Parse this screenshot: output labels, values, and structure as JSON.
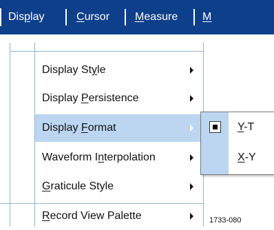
{
  "menubar": {
    "items": [
      {
        "label_pre": "Dis",
        "label_u": "p",
        "label_post": "lay"
      },
      {
        "label_pre": "",
        "label_u": "C",
        "label_post": "ursor"
      },
      {
        "label_pre": "",
        "label_u": "M",
        "label_post": "easure"
      },
      {
        "label_pre": "",
        "label_u": "M",
        "label_post": ""
      }
    ]
  },
  "menu": {
    "items": [
      {
        "pre": "Display St",
        "u": "y",
        "post": "le",
        "has_submenu": true
      },
      {
        "pre": "Display ",
        "u": "P",
        "post": "ersistence",
        "has_submenu": true
      },
      {
        "pre": "Display ",
        "u": "F",
        "post": "ormat",
        "has_submenu": true,
        "selected": true
      },
      {
        "pre": "Waveform I",
        "u": "n",
        "post": "terpolation",
        "has_submenu": true
      },
      {
        "pre": "",
        "u": "G",
        "post": "raticule Style",
        "has_submenu": true
      },
      {
        "pre": "",
        "u": "R",
        "post": "ecord View Palette",
        "has_submenu": true
      }
    ]
  },
  "submenu": {
    "items": [
      {
        "pre": "",
        "u": "Y",
        "post": "-T",
        "checked": true
      },
      {
        "pre": "",
        "u": "X",
        "post": "-Y",
        "checked": false
      }
    ]
  },
  "figure_id": "1733-080",
  "colors": {
    "menubar_bg": "#0d3f8a",
    "highlight": "#bcd6f2",
    "guide_lines": "#8fb3d3"
  }
}
